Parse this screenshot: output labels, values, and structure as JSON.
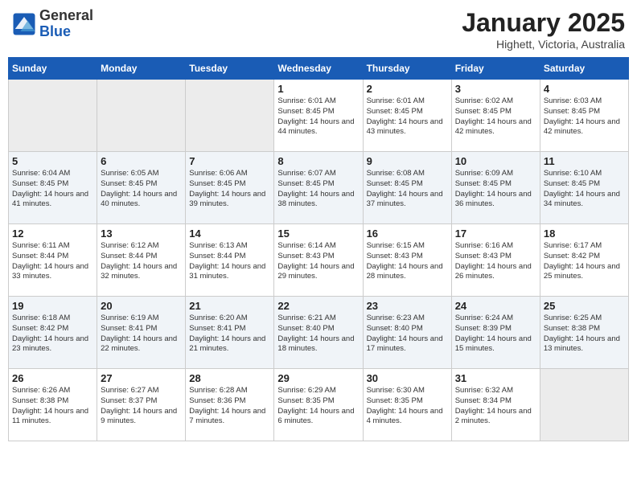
{
  "header": {
    "logo_general": "General",
    "logo_blue": "Blue",
    "month_title": "January 2025",
    "location": "Highett, Victoria, Australia"
  },
  "weekdays": [
    "Sunday",
    "Monday",
    "Tuesday",
    "Wednesday",
    "Thursday",
    "Friday",
    "Saturday"
  ],
  "weeks": [
    {
      "days": [
        {
          "num": "",
          "empty": true
        },
        {
          "num": "",
          "empty": true
        },
        {
          "num": "",
          "empty": true
        },
        {
          "num": "1",
          "sunrise": "6:01 AM",
          "sunset": "8:45 PM",
          "daylight": "14 hours and 44 minutes."
        },
        {
          "num": "2",
          "sunrise": "6:01 AM",
          "sunset": "8:45 PM",
          "daylight": "14 hours and 43 minutes."
        },
        {
          "num": "3",
          "sunrise": "6:02 AM",
          "sunset": "8:45 PM",
          "daylight": "14 hours and 42 minutes."
        },
        {
          "num": "4",
          "sunrise": "6:03 AM",
          "sunset": "8:45 PM",
          "daylight": "14 hours and 42 minutes."
        }
      ]
    },
    {
      "days": [
        {
          "num": "5",
          "sunrise": "6:04 AM",
          "sunset": "8:45 PM",
          "daylight": "14 hours and 41 minutes."
        },
        {
          "num": "6",
          "sunrise": "6:05 AM",
          "sunset": "8:45 PM",
          "daylight": "14 hours and 40 minutes."
        },
        {
          "num": "7",
          "sunrise": "6:06 AM",
          "sunset": "8:45 PM",
          "daylight": "14 hours and 39 minutes."
        },
        {
          "num": "8",
          "sunrise": "6:07 AM",
          "sunset": "8:45 PM",
          "daylight": "14 hours and 38 minutes."
        },
        {
          "num": "9",
          "sunrise": "6:08 AM",
          "sunset": "8:45 PM",
          "daylight": "14 hours and 37 minutes."
        },
        {
          "num": "10",
          "sunrise": "6:09 AM",
          "sunset": "8:45 PM",
          "daylight": "14 hours and 36 minutes."
        },
        {
          "num": "11",
          "sunrise": "6:10 AM",
          "sunset": "8:45 PM",
          "daylight": "14 hours and 34 minutes."
        }
      ]
    },
    {
      "days": [
        {
          "num": "12",
          "sunrise": "6:11 AM",
          "sunset": "8:44 PM",
          "daylight": "14 hours and 33 minutes."
        },
        {
          "num": "13",
          "sunrise": "6:12 AM",
          "sunset": "8:44 PM",
          "daylight": "14 hours and 32 minutes."
        },
        {
          "num": "14",
          "sunrise": "6:13 AM",
          "sunset": "8:44 PM",
          "daylight": "14 hours and 31 minutes."
        },
        {
          "num": "15",
          "sunrise": "6:14 AM",
          "sunset": "8:43 PM",
          "daylight": "14 hours and 29 minutes."
        },
        {
          "num": "16",
          "sunrise": "6:15 AM",
          "sunset": "8:43 PM",
          "daylight": "14 hours and 28 minutes."
        },
        {
          "num": "17",
          "sunrise": "6:16 AM",
          "sunset": "8:43 PM",
          "daylight": "14 hours and 26 minutes."
        },
        {
          "num": "18",
          "sunrise": "6:17 AM",
          "sunset": "8:42 PM",
          "daylight": "14 hours and 25 minutes."
        }
      ]
    },
    {
      "days": [
        {
          "num": "19",
          "sunrise": "6:18 AM",
          "sunset": "8:42 PM",
          "daylight": "14 hours and 23 minutes."
        },
        {
          "num": "20",
          "sunrise": "6:19 AM",
          "sunset": "8:41 PM",
          "daylight": "14 hours and 22 minutes."
        },
        {
          "num": "21",
          "sunrise": "6:20 AM",
          "sunset": "8:41 PM",
          "daylight": "14 hours and 21 minutes."
        },
        {
          "num": "22",
          "sunrise": "6:21 AM",
          "sunset": "8:40 PM",
          "daylight": "14 hours and 18 minutes."
        },
        {
          "num": "23",
          "sunrise": "6:23 AM",
          "sunset": "8:40 PM",
          "daylight": "14 hours and 17 minutes."
        },
        {
          "num": "24",
          "sunrise": "6:24 AM",
          "sunset": "8:39 PM",
          "daylight": "14 hours and 15 minutes."
        },
        {
          "num": "25",
          "sunrise": "6:25 AM",
          "sunset": "8:38 PM",
          "daylight": "14 hours and 13 minutes."
        }
      ]
    },
    {
      "days": [
        {
          "num": "26",
          "sunrise": "6:26 AM",
          "sunset": "8:38 PM",
          "daylight": "14 hours and 11 minutes."
        },
        {
          "num": "27",
          "sunrise": "6:27 AM",
          "sunset": "8:37 PM",
          "daylight": "14 hours and 9 minutes."
        },
        {
          "num": "28",
          "sunrise": "6:28 AM",
          "sunset": "8:36 PM",
          "daylight": "14 hours and 7 minutes."
        },
        {
          "num": "29",
          "sunrise": "6:29 AM",
          "sunset": "8:35 PM",
          "daylight": "14 hours and 6 minutes."
        },
        {
          "num": "30",
          "sunrise": "6:30 AM",
          "sunset": "8:35 PM",
          "daylight": "14 hours and 4 minutes."
        },
        {
          "num": "31",
          "sunrise": "6:32 AM",
          "sunset": "8:34 PM",
          "daylight": "14 hours and 2 minutes."
        },
        {
          "num": "",
          "empty": true
        }
      ]
    }
  ]
}
